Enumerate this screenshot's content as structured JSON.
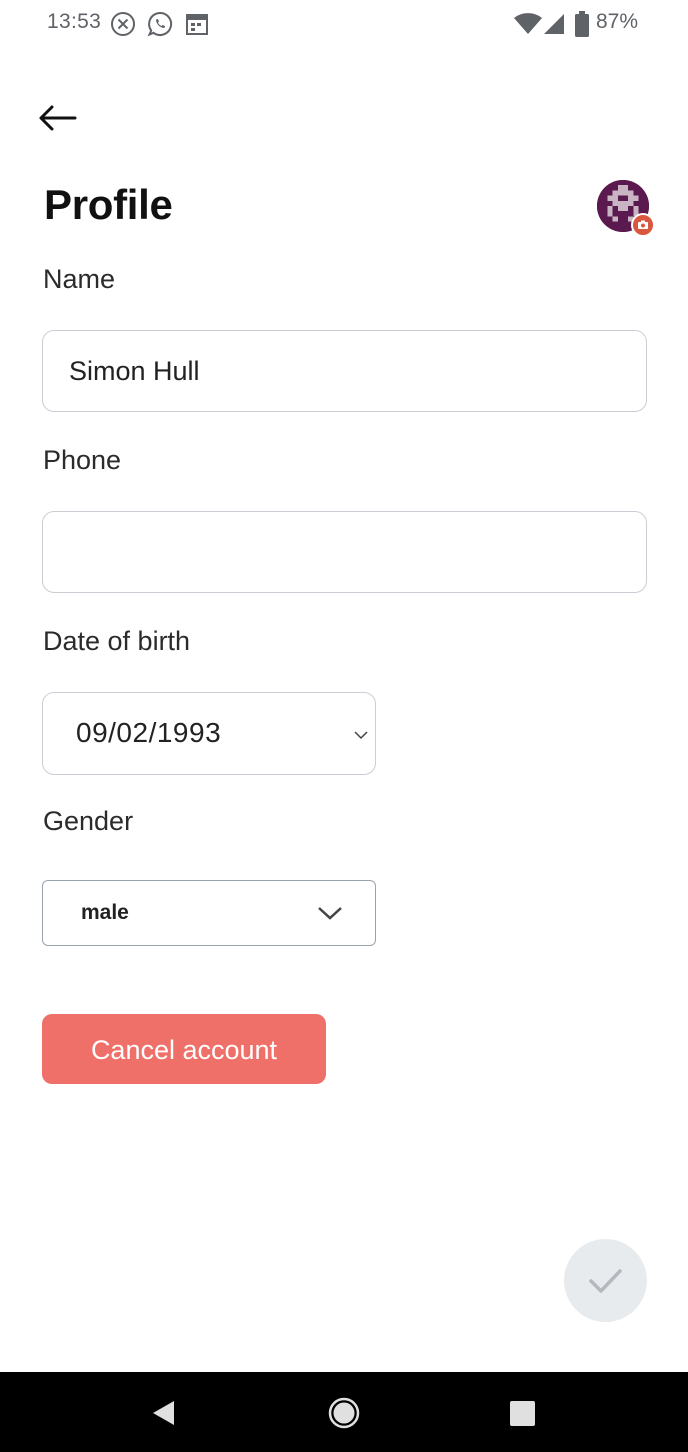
{
  "status_bar": {
    "time": "13:53",
    "battery": "87%",
    "icons": [
      "close-circle-icon",
      "whatsapp-icon",
      "calendar-icon",
      "wifi-icon",
      "signal-icon",
      "battery-icon"
    ]
  },
  "header": {
    "back_icon": "arrow-left-icon",
    "title": "Profile"
  },
  "avatar": {
    "icon": "pixel-avatar",
    "badge_icon": "camera-icon",
    "badge_color": "#d9573f",
    "background_color": "#5b1a4f"
  },
  "form": {
    "name_label": "Name",
    "name_value": "Simon Hull",
    "phone_label": "Phone",
    "phone_value": "",
    "dob_label": "Date of birth",
    "dob_value": "09/02/1993",
    "gender_label": "Gender",
    "gender_value": "male"
  },
  "actions": {
    "cancel_label": "Cancel account",
    "cancel_color": "#ee7068",
    "confirm_icon": "checkmark-icon"
  },
  "nav_bar": {
    "icons": [
      "back-triangle-icon",
      "home-circle-icon",
      "recents-square-icon"
    ]
  }
}
